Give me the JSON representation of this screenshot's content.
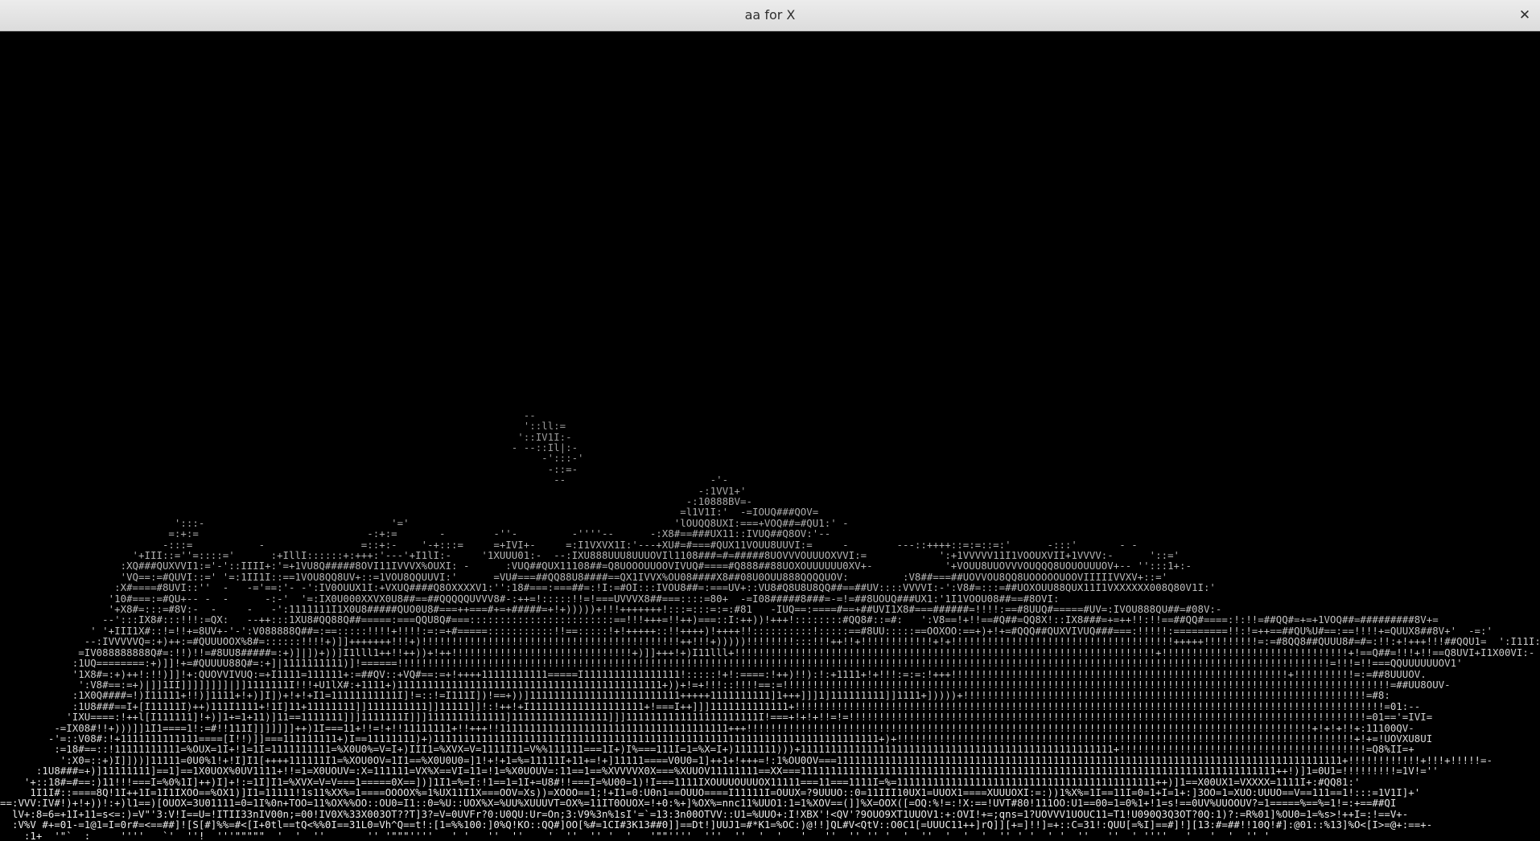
{
  "window": {
    "title": "aa for X",
    "close_glyph": "✕"
  },
  "terminal": {
    "lines": [
      "                                                                                                                                                                                   ",
      "                                                                                       --                                                                                                                                   ",
      "                                                                                       '::ll:=                                                                                                                              ",
      "                                                                                      '::IV1I:-                                                                                                                             ",
      "                                                                                     - --::Il|:-                                                                                                                            ",
      "                                                                                          -':::-'                                                                                                                           ",
      "                                                                                           -::=-                                                                                                                            ",
      "                                                                                            --                        -'-                                                                                                   ",
      "                                                                                                                    -:1VV1+'                                                                                                ",
      "                                                                                                                  -:10888BV=-                                                                                               ",
      "                                                                                                                 =l1V1I:'  -=IOUQ###QOV=                                                                                    ",
      "                             ':::-                               '='                                            'lOUQQ8UXI:===+VOQ##=#QU1:' -                                                                               ",
      "                            =:+:=                            -:+:=       -        -''-         -''''--      -:X8#==###UX11::IVUQ##Q8OV:'--                                                                                ",
      "                           -:::=           -                =::+:-    '-+:::=     =+IVI+-     =:I1VXVX1I:'---+XU#=#===#QUX11VOUU8UUVI:=     -        ---::++++::=:=::=:'      -:::'       - -                                ",
      "                      '+III::=''=::::='      :+IllI::::::+:+++:'---'+I1lI:-     '1XUUU01:-  --:IXU888UUU8UUUOVIl1108###=#=#####8UOVVVOUUUOXVVI:=            ':+1VVVVV11I1VOOUXVII+1VVVV:-      '::='                           ",
      "                    :XQ###QUXVVI1:='-'::IIII+:'=+1VU8Q#####8OVI11IVVVX%OUXI: -      :VUQ##QUX11108##=Q8UOOOUUOOVIVUQ#====#Q888##88UOXOUUUUUU0XV+-            '+VOUU8UUOVVVOUQQQ8UOUOUUUOV+-- '':::1+:-                      ",
      "                    'VQ==:=#QUVI::=' '=:1II1I::==1VOU8QQ8UV+::=1VOU8QQUUVI:'      =VU#===##QQ88U8####==QX1IVVX%OU08####X8##08U0OUU888QQQQUOV:         :V8##===##UOVVOU8QQ8UOOOOOUOOVIIIIIVVXV+::='                        ",
      "                   :X#====#8UVI::''  -   -='==:'- -':IV0OUUX1I:+VXUQ####Q8OXXXXV1:'':18#===:===##=:!I:=#OI:::IVOU8##=:===UV+::VU8#Q8U8U8QQ##==##UV::::VVVVI:-':V8#=:::=##UOXOUU88QUX11I1VXXXXXX008Q80V1I:'                  ",
      "                  '10#===:=#QU+-- -  -      -:-'  '=:IX0U000XXVX0U8##==##QQQQQUVVV8#-:++=!:::::!!=!===UVVVX8##===::::=80+  -=I08#####8###=-=!=##8UOUQ###UX1:'1I1VOOU08##==#8OVI:                  ",
      "                  '+X8#=:::=#8V:-  -     -   -':1111111I1X0U8#####QUO0U8#===++===#+=+#####=+!+)))))+!!!+++++++!:::=:::=:=:#81   -IUQ==:====#==+##UVI1X8#===######=!!!!:==#8UUQ#=====#UV=:IVOU888QU##=#08V:-            ",
      "                 --':::IX8#:::!!!:=QX:   --++:::1XU8#QQ88Q##=====:===QQU8Q#===::::::::::::::::::::::::==!!!+++=!!++)===::I:++))!+++!::::::::#QQ8#::=#:   ':V8==!+!!==#Q##=QQ8X!::IX8###=+=++!!:!!==##QQ#====:!:!!=##QQ#=+=+1VOQ##=#########8V+=       ",
      "               ' '+III1X#::!=!!+=8UV+-'-':V088888Q##=:==:::::!!!!+!!!!:=:=+#=====:::::::::::!!==:::::!+!+++++::!!++++)!++++!!::::::::::!:::::==#8UU:::::==OOXOO:==+)+!+=#QQQ##QUXVIVUQ###===:!!!!!:=========!!:!=++==##QU%U#==:==!!!!+=QUUX8##8V+'  -=:'       ",
      "              --:IVVVVVQ=:+)++:=#QUUUOOX%8#=::::::!!!!+)]]+++++++!!!+)!!!!!!!!!!!!!!!!!!!!!!!!!!!!!!!!!!!!!!!!!!!++!!!+)))))!!!!!!!!:::!!!++!!+!!!!!!!!!!!!+!+!!!!!!!!!!!!!!!!!!!!!!!!!!!!!!!!!!!!!+++++!!!!!!!!!=:=#8QQ8##QUUU8#=#=:!!:+!+++!!!##QQU1=  ':I11I:-   ",
      "             =IV088888888Q#=:!!)!!=#8UU8#####=:+)]|])+))]I1lll1++!!++))+!++!!!!!!!!!!!!!!!!!!!!!!!!!!!!!!+)]]+++!+)I11lll+!!!!!!!!!!!!!!!!!!!!!!!!!!!!!!!!!!!!!!!!!!!!!!!!!!!!!!!!!!!!!!!!!!!!!!+!!!!!!!!!!!!!!!!!!!!!!!!!!!!!!!+!==Q##=!!!+!!==Q8UVI+I1X00VI:-  ",
      "            :1UQ========:+)]]!+=#QUUUU88Q#=:+]|1111111111)]!======!!!!!!!!!!!!!!!!!!!!!!!!!!!!!!!!!!!!!!!!!!!!!!!!!!!!!!!!!!!!!!!!!!!!!!!!!!!!!!!!!!!!!!!!!!!!!!!!!!!!!!!!!!!!!!!!!!!!!!!!!!!!!!!!!!!!!!!!!!!!!!!!!!!!!!!!!!!=!!!=!!===QQUUUUUUOV1'   ",
      "            '1X8#=:+)++!:!!)]]!+:QUOVVIVUQ:=+I1111=111111+:=##QV::+VQ#==:=+!++++11111111111=====I1111111111111111!:::::!+!:====:!++)!!):!:+1111+!+!!!:=:=:!+++!!!!!!!!!!!!!!!!!!!!!!!!!!!!!!!!!!!!!!!!!!!!!!!!!!!!!!!!+!!!!!!!!!!=:=##8UUUOV.   ",
      "             ':V8#==:=+)|]]1II]]]]]]]]|]]1111111I!!!+U1lX#:+1111+)11111111111111111111111111111111111111111111+))+!=+!!!::!!!!==:=!!!!!!!!!!!!!!!!!!!!!!!!!!!!!!!!!!!!!!!!!!!!!!!!!!!!!!!!!!!!!!!!!!!!!!!!!!!!!!!!!!!!!!!!!!!!!!!!!!!!!=##UU8OUV- ",
      "            :1X0Q####=!)I11111+!!)]1111+!+)]I])+!+!+I1=11111111111I]!=::!=I111I])!==+))]1111111111111111111111111+++++1111111111]1+++]]]1]111111111]]1111+]))))+!!!!!!!!!!!!!!!!!!!!!!!!!!!!!!!!!!!!!!!!!!!!!!!!!!!!!!!!!!!!!!!!!!!=#8:    ",
      "            :1U8###==I+[I11111I)++)111I1111+!1I]11+11111111]]1111111111]]11111]]!:!++!+I1111111111111111111+!===I++]]]1111111111111+!!!!!!!!!!!!!!!!!!!!!!!!!!!!!!!!!!!!!!!!!!!!!!!!!!!!!!!!!!!!!!!!!!!!!!!!!!!!!!!!!!!!!!!!!!!!!!!!!!=01:-- ",
      "           'IXU====:!++l[I111111]!+)]1+=1+11)]11==1111111]]]1111111I]]]1111111111111]1111111111111111]]]1111111111111111111111I!===+!+!+!!=!=!!!!!!!!!!!!!!!!!!!!!!!!!!!!!!!!!!!!!!!!!!!!!!!!!!!!!!!!!!!!!!!!!!!!!!!!!!!!!!!!!!!!!!=01=='=IVI= ",
      "         -=IX08#!!+)))]]1I1====1!:=#!!111I]]]]]]]++)1I===11+!!=!+!!11111111+!!+++!!11111111111111111111111111111111111111+++!!!!!!!!!!!!!!!!!!!!!!!!!!!!!!!!!!!!!!!!!!!!!!!!!!!!!!!!!!!!!!!!!!!!!!!!!!!!!!!!!!!!!!!!!!!!!!+!+!+!!+:11100QV- ",
      "        -'=::V08#:!+1111111111111====[I!!)]]===111111111+)I==11111111)+)111111111111111111111I1111111111111111111111111111111111111111111111111111+)+!!!!!!!!!!!!!!!!!!!!!!!!!!!!!!!!!!!!!!!!!!!!!!!!!!!!!!!!!!!!!!!!!!!!!!!!!!!!+!+=!UOVXU8UI ",
      "         :=18#==::!11111111111=%OUX=1I+!1=1I=1111111111=%X0U0%=V=I+)III1=%XVX=V=1111I11=V%%111111===1I+)I%===111I=1=%X=I+)1111111)))+1111111111111111111111111111111111111111111111111111+!!!!!!!!!!!!!!!!!!!!!!!!!!!!!!!!!!!!!!!!!=Q8%II=+  ",
      "          ':X0=::+)I]]))]11111=0U0%1!+!I]I1[++++111111I1=%XOU0OV=1I1==%X0U0U0=]1!+!+1=%=11111I+11+=!+]11111====V0U0=1]++1+!+++=!:1%OU0OV===111111111111111111111111111111111111111111111111111111111111111111111111111111111111+!!!!!!!!!!!!+!!!+!!!!!=-  ",
      "      :1U8###=+)]11111111]==1]==1X0UOX%0UV1111+!!=1=X0UOUV=:X=111111=VX%X==VI=11=!1=%X0UOUV=:11==1==%XVVVVX0X===%XUUOV11111111==XX===1111111111111111111111111111111111111111111111111111111111111111111111111111111++!)]1=0U1=!!!!!!!!!=1V!=''  ",
      "    '+::18#=#==:)11!!!===I=%0%1I]++)I]+!:=1I]I1=%XVX=V=V===1=====0X==])]1I1=%=I:!1==1=1I+=U8#!!===I=%U00=1)!I===1111IXOUUUOUUUOX11111===11===1111I=%=1111111111111111111111111111111111111111111++)]1==X00UX1=VXXXX=1111I+:#QQ81:'  ",
      "     1I1I#::====8Q!1I++1I=1I1IXOO==%OX1)]I1=11111!1s11%XX%=1====OOOOX%=1%UX11I1X===OOV=Xs))=XOOO==1;!+I1=0:U0n1==OUUO====I11111I=OUUX=?9UUUO::0=11III10UX1=UUOX1====XUUUOXI:=:))1%X%=1I==11I=0=1+I=1+:]3OO=1=XUO:UUUO==V==111==1!:::=1V1I]+'  ",
      "==:VVV:IV#!)+!+))!:+)l1==)[OUOX=3U01111=0=1I%0n+TOO=11%OX%%OO::OU0=I1::0=%U::UOX%X=%UU%XUUUVT=OX%=11IT0OUOX=!+0:%+]%OX%=nnc11%UUO1:1=1%XOV==(]]%X=OOX([=OQ:%!=:!X:==!UVT#80!111OO:U1==00=1=0%1+!1=s!==0UV%UUOOUV?=1=====%==%=1!=:+==##QI ",
      "  lV+:8=6=+1I+11=s<=:)=V\"'3:V!I==U=!ITII33nIV00n;=00!IV0X%33X003OT??T]3?=V=0UVFr?0:U0QU:Ur=On;3:V9%3n%1sI'=`=13:3n00OTVV::U1=%UUO+:I!XBX'!<QV'?9OUO9XT1UUOV1:+:OVI!+=;qns=1?UOVVV1UOUC11=T1!U090Q3Q3OT?0Q:1)?:=R%01]%OU0=1=%s>!++I=:!==V+- ",
      "  :V%V #+=01-=1@1=I=0r#=<==##]![S[#]%%=#<[I+0tl==tQ<%%0I==31L0=Vh^Q==t!:[1=%%100:]0%Q!KO::QQ#]OO[%#=1CI#3K13##0]]==Dt!]UUJ1=#*K1=%OC:)@!!]QL#V<QtV::O0C1[=UUUC11++]rQ]][+=]!!]=+::C=31!:QUU[=%I]==#]!][13:#=##!!10Q!#]:@01::%13]%O<[I>=@+:==+- ",
      "    :1+  '\"`  :     ''''   `'  ''!  '''\"\"\"\"\"  '  '  ''       '' '\"\"\"''''   ' '   ''  ''    '  ''  '' '  '   '\"\"''''  '''  ''  '  '   '   ''  '' '' '  '  ''  '  '  '  '' ' '  ' '  ''   ''  ' ''''   '   '  '  '' '  "
    ]
  }
}
